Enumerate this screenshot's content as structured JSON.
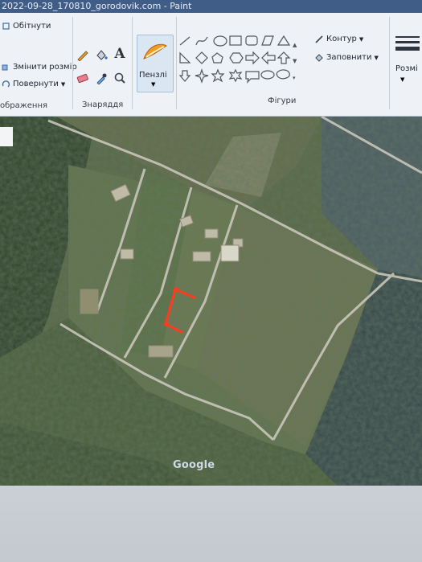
{
  "window": {
    "title": "2022-09-28_170810_gorodovik.com - Paint"
  },
  "ribbon": {
    "image_group": {
      "crop_label": "Обітнути",
      "resize_label": "Змінити розмір",
      "rotate_label": "Повернути",
      "group_label": "ображення"
    },
    "tools_group": {
      "group_label": "Знаряддя",
      "tools": [
        "pencil-icon",
        "fill-icon",
        "text-icon",
        "eraser-icon",
        "color-picker-icon",
        "magnifier-icon"
      ]
    },
    "brushes": {
      "label": "Пензлі"
    },
    "shapes_group": {
      "group_label": "Фігури",
      "outline_label": "Контур",
      "fill_label": "Заповнити"
    },
    "size": {
      "label": "Розмі"
    }
  },
  "map": {
    "watermark": "Google",
    "colors": {
      "marker": "#ff3b1f",
      "roads": "#c9c6bb"
    }
  }
}
